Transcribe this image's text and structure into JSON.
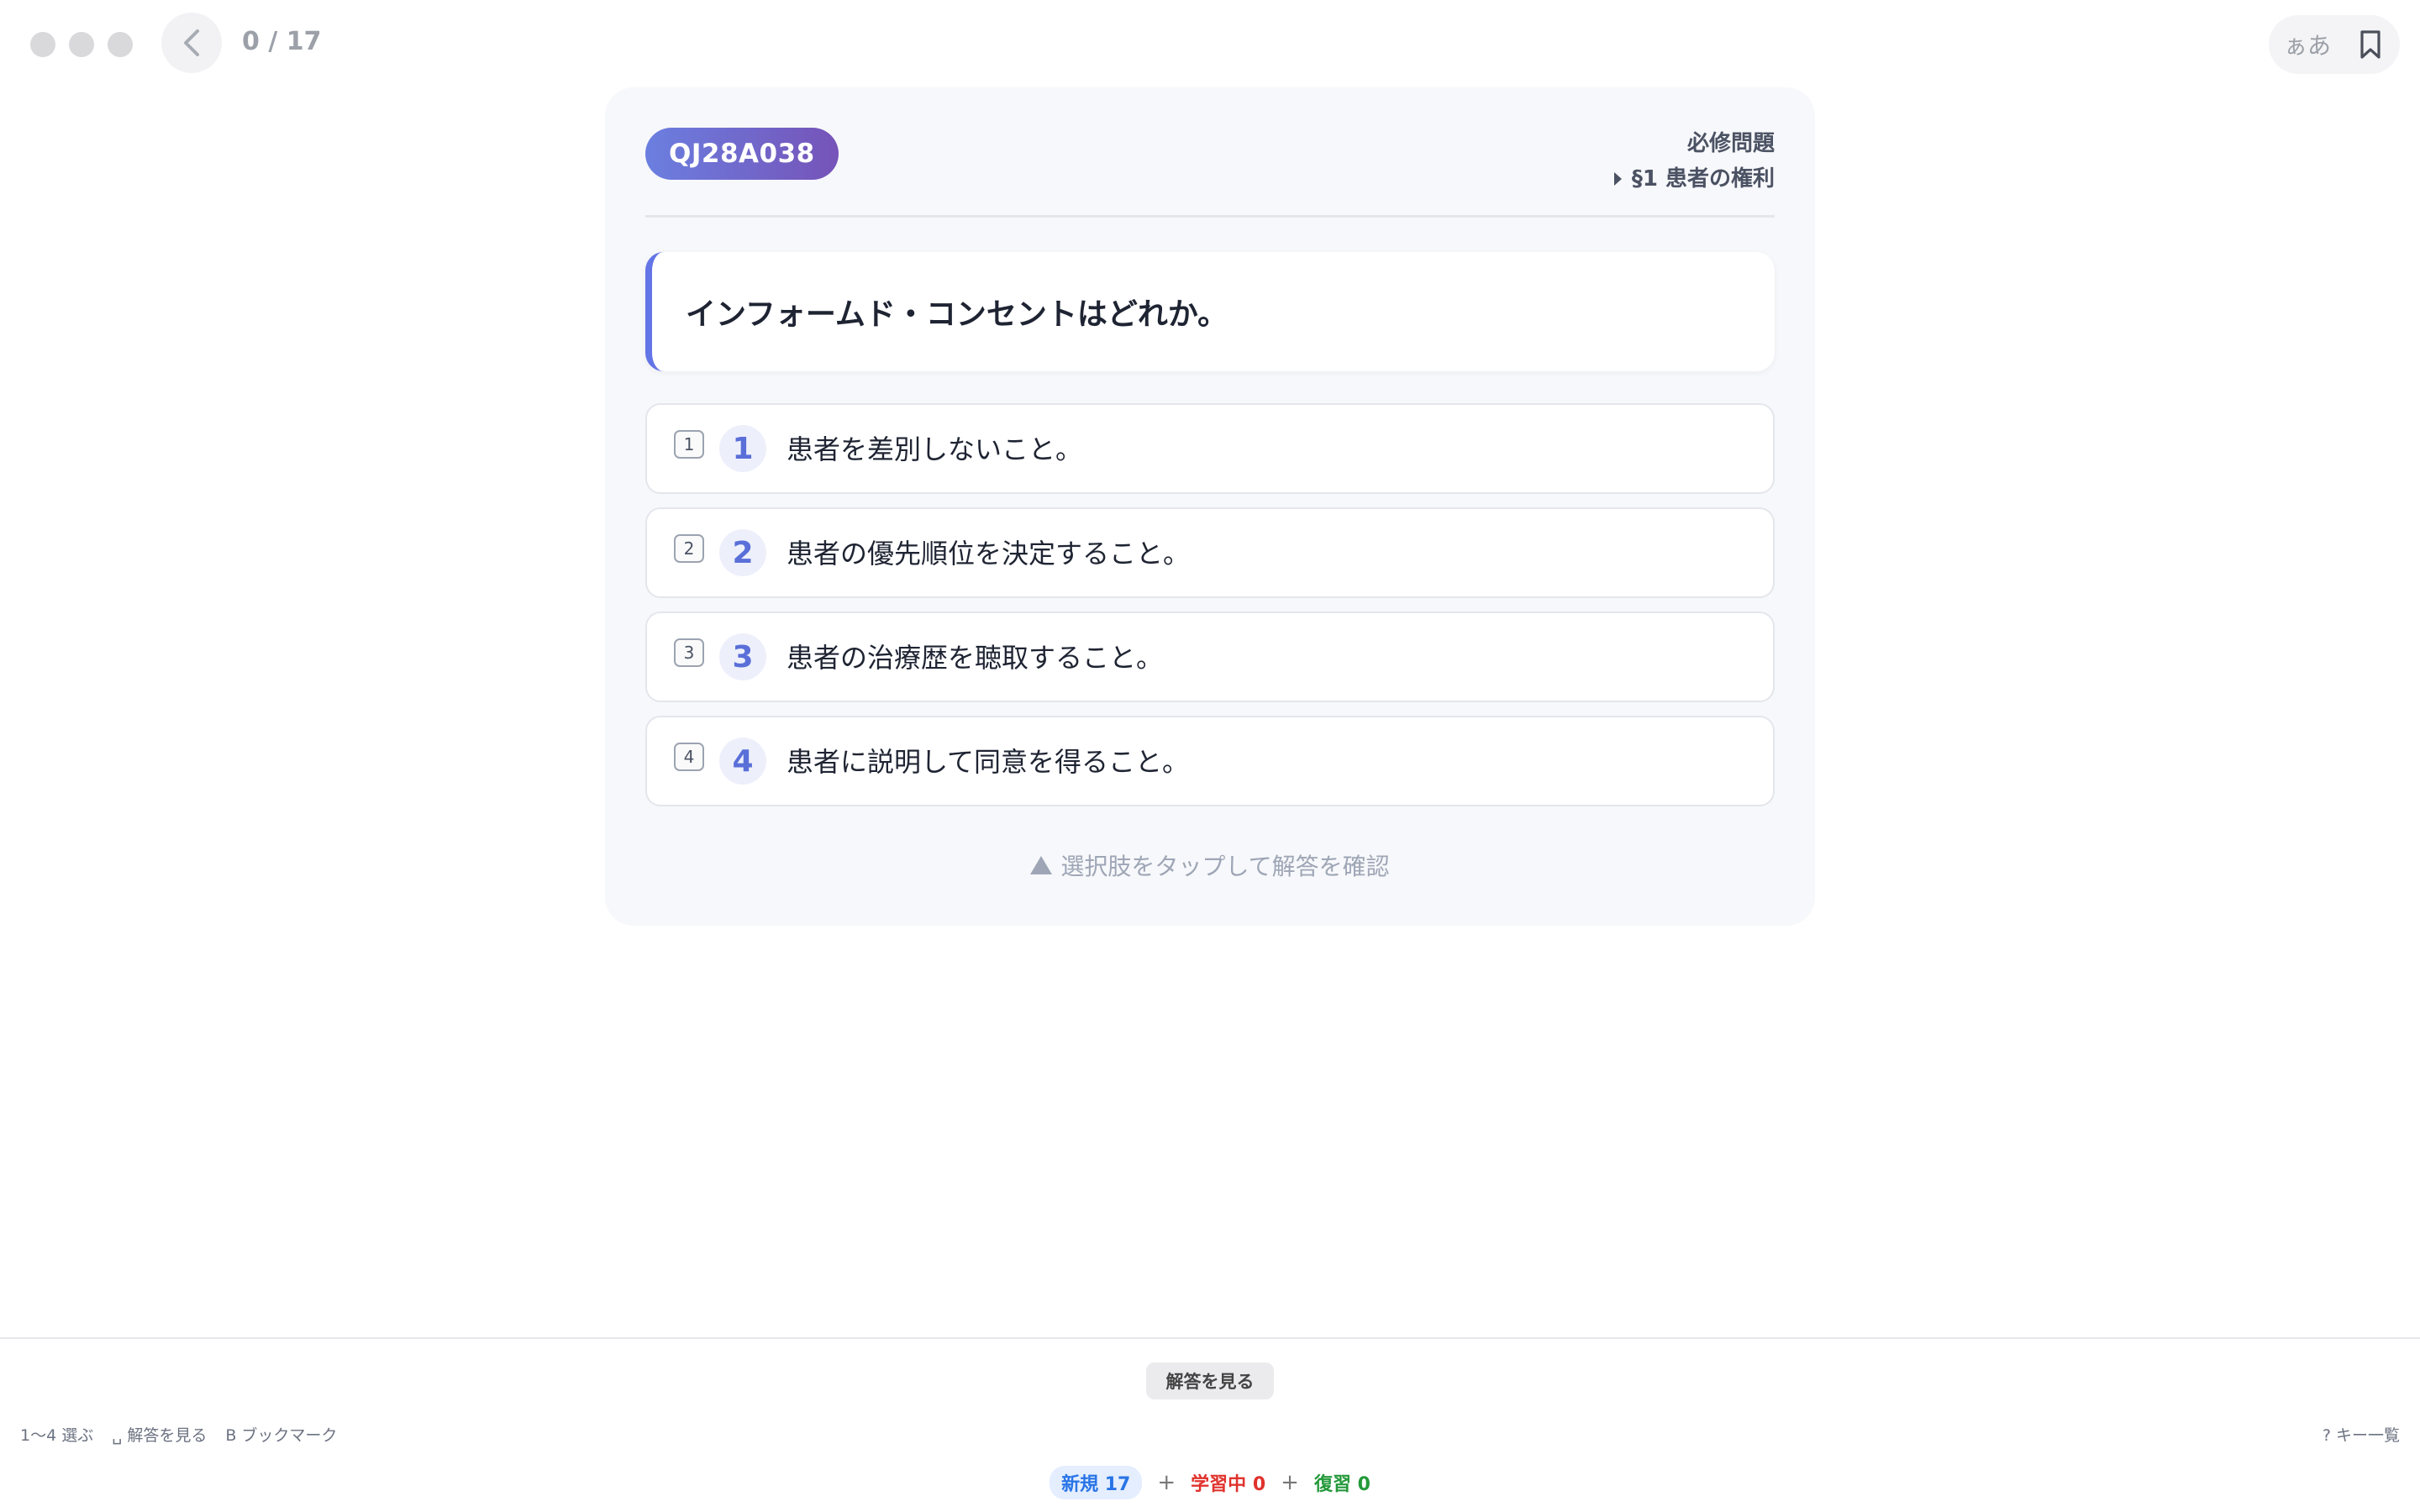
{
  "header": {
    "progress": "0 / 17",
    "font_toggle_label": "ぁあ"
  },
  "card": {
    "question_id": "QJ28A038",
    "category": "必修問題",
    "section": "§1 患者の権利",
    "question": "インフォームド・コンセントはどれか。",
    "choices": [
      {
        "key": "1",
        "number": "1",
        "text": "患者を差別しないこと。"
      },
      {
        "key": "2",
        "number": "2",
        "text": "患者の優先順位を決定すること。"
      },
      {
        "key": "3",
        "number": "3",
        "text": "患者の治療歴を聴取すること。"
      },
      {
        "key": "4",
        "number": "4",
        "text": "患者に説明して同意を得ること。"
      }
    ],
    "hint": "選択肢をタップして解答を確認"
  },
  "footer": {
    "show_answer_label": "解答を見る",
    "shortcuts": [
      "1〜4 選ぶ",
      "␣ 解答を見る",
      "B ブックマーク"
    ],
    "key_list_label": "? キー一覧",
    "stats": {
      "new": "新規 17",
      "learning": "学習中 0",
      "review": "復習 0",
      "separator": "+"
    }
  },
  "colors": {
    "accent": "#6274e6",
    "badge_gradient_start": "#6b7fe0",
    "badge_gradient_end": "#7653b8",
    "new": "#2874e6",
    "learning": "#e0322c",
    "review": "#24993a"
  }
}
